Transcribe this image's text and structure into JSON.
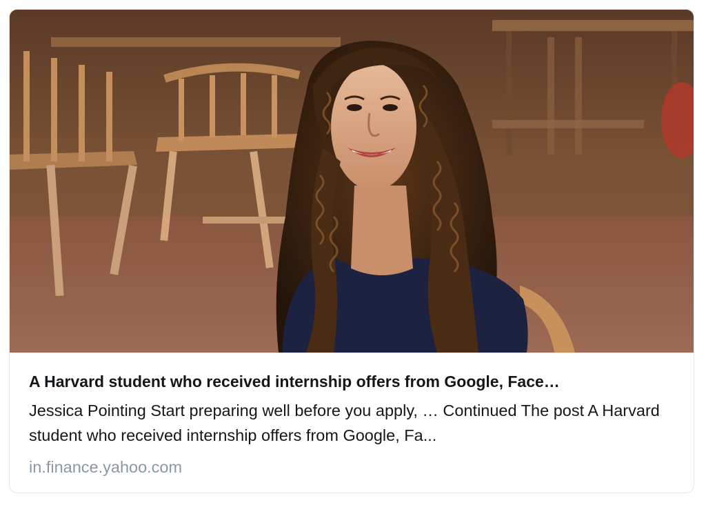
{
  "card": {
    "image_alt": "Photo of a smiling young woman with long curly hair seated in a wood-furnished room",
    "headline": "A Harvard student who received internship offers from Google, Face…",
    "summary": "Jessica Pointing Start preparing well before you apply, … Continued The post A Harvard student who received internship offers from Google, Fa...",
    "domain": "in.finance.yahoo.com"
  }
}
